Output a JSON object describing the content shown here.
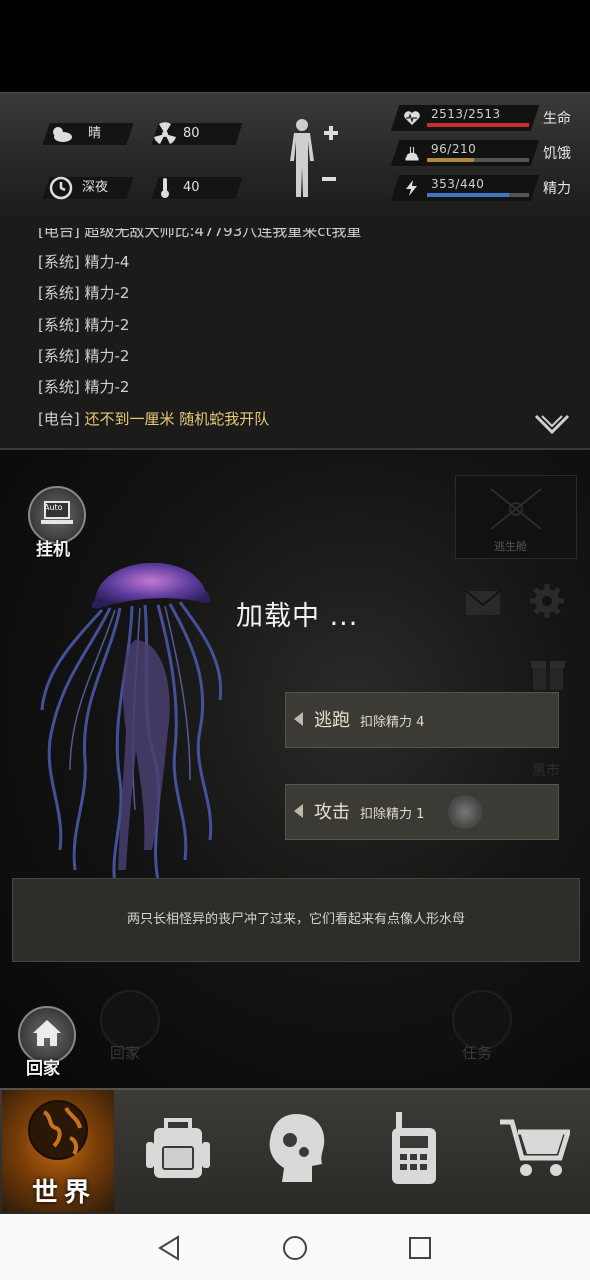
{
  "status": {
    "weather": "晴",
    "radiation": "80",
    "time_of_day": "深夜",
    "temperature": "40",
    "bars": [
      {
        "value_text": "2513/2513",
        "label": "生命",
        "fill": 1.0,
        "color": "#c23232",
        "icon": "heart-pulse-icon"
      },
      {
        "value_text": "96/210",
        "label": "饥饿",
        "fill": 0.457,
        "color": "#b08a3a",
        "icon": "food-icon"
      },
      {
        "value_text": "353/440",
        "label": "精力",
        "fill": 0.802,
        "color": "#3d78c4",
        "icon": "energy-icon"
      }
    ]
  },
  "log": {
    "top_partial": "[电台] 超级无敌大帅比:47793八连我重来ct我重",
    "lines": [
      {
        "tag": "[系统]",
        "text": "精力-4"
      },
      {
        "tag": "[系统]",
        "text": "精力-2"
      },
      {
        "tag": "[系统]",
        "text": "精力-2"
      },
      {
        "tag": "[系统]",
        "text": "精力-2"
      },
      {
        "tag": "[系统]",
        "text": "精力-2"
      }
    ],
    "radio": {
      "tag": "[电台]",
      "text": "还不到一厘米 随机蛇我开队"
    }
  },
  "combat": {
    "auto_badge": "Auto",
    "auto_label": "挂机",
    "loading_text": "加载中 ...",
    "flee": {
      "label": "逃跑",
      "cost": "扣除精力 4"
    },
    "attack": {
      "label": "攻击",
      "cost": "扣除精力 1"
    },
    "description": "两只长相怪异的丧尸冲了过来，它们看起来有点像人形水母",
    "faded": {
      "escape_pod": "逃生舱",
      "market": "黑市",
      "home_dim": "回家",
      "task_dim": "任务"
    },
    "home_label": "回家"
  },
  "nav": {
    "world_label": "世界",
    "items": [
      "backpack-icon",
      "skills-head-icon",
      "radio-walkie-icon",
      "shop-cart-icon"
    ]
  }
}
